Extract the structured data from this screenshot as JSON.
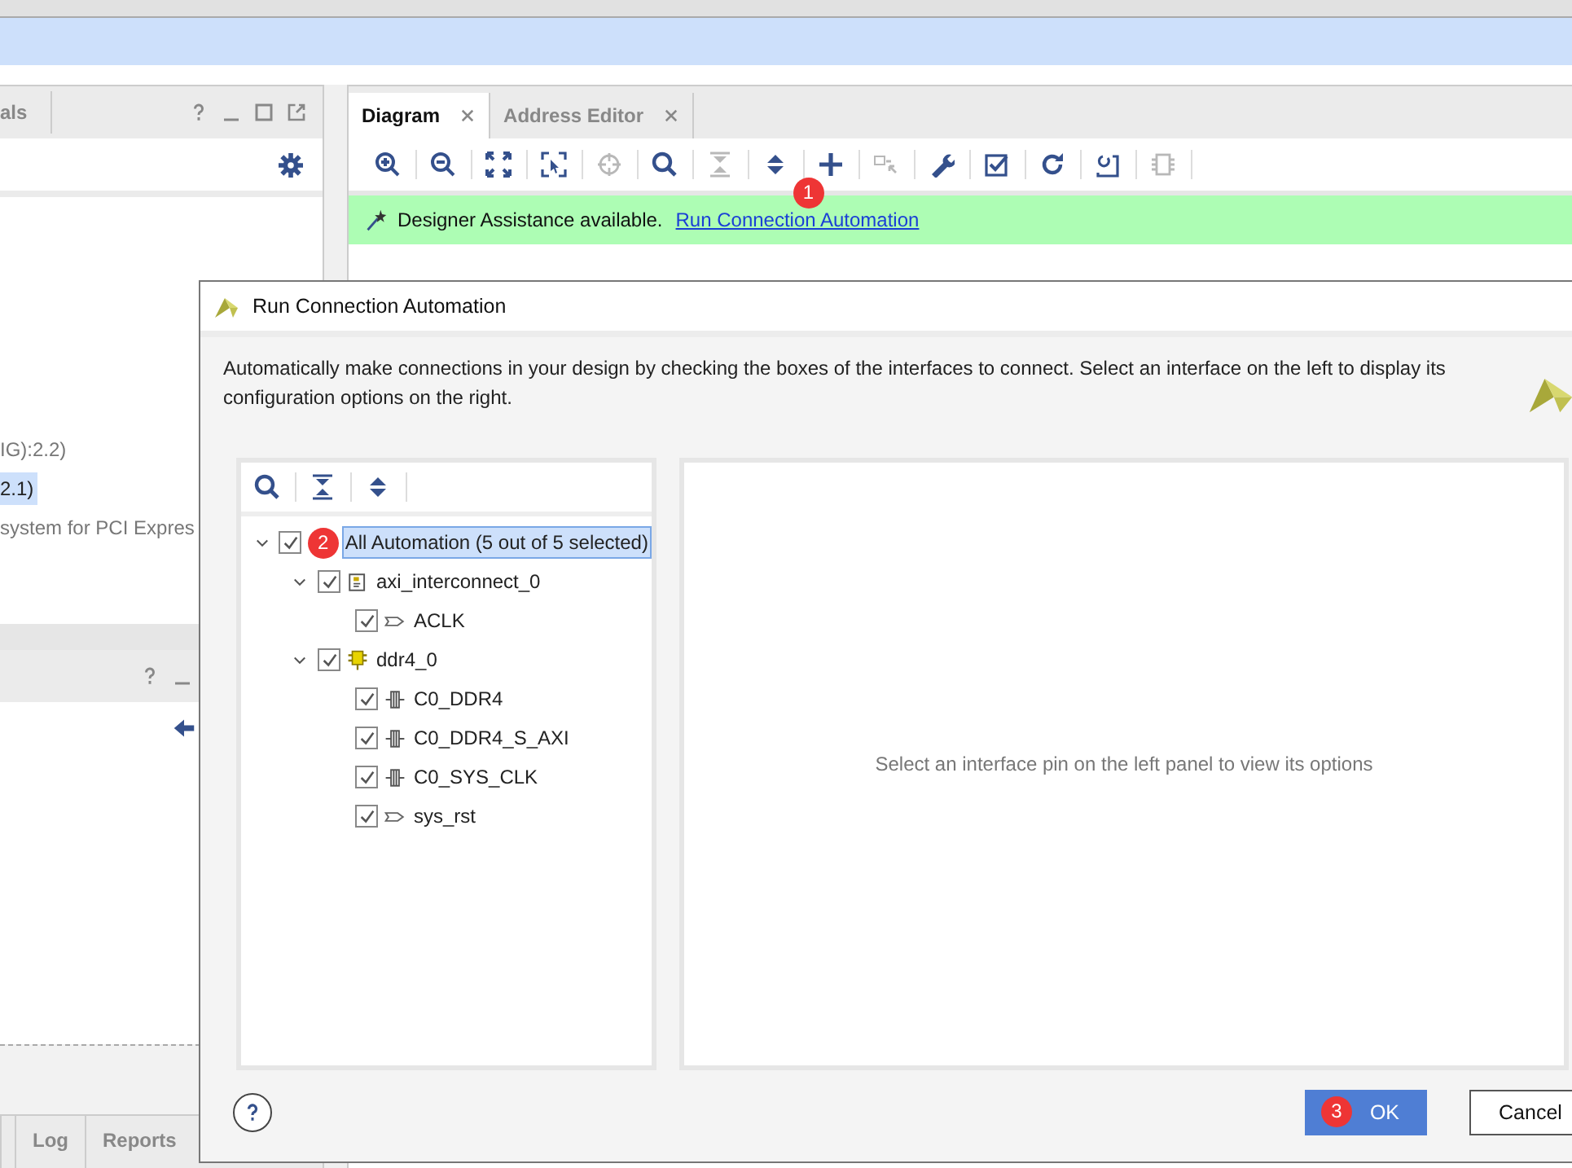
{
  "left_panel": {
    "tab": "als",
    "lines": [
      {
        "text": "IG):2.2)",
        "selected": false
      },
      {
        "text": "2.1)",
        "selected": true
      },
      {
        "text": "system for PCI Expres",
        "selected": false
      }
    ]
  },
  "bottom_tabs": [
    {
      "label": "Log"
    },
    {
      "label": "Reports"
    }
  ],
  "diagram_tabs": [
    {
      "label": "Diagram",
      "selected": true
    },
    {
      "label": "Address Editor",
      "selected": false
    }
  ],
  "diagram_toolbar": [
    {
      "kind": "zoom-in",
      "disabled": false
    },
    {
      "kind": "zoom-out",
      "disabled": false
    },
    {
      "kind": "fit",
      "disabled": false
    },
    {
      "kind": "select-area",
      "disabled": false
    },
    {
      "kind": "crosshair",
      "disabled": true
    },
    {
      "kind": "search",
      "disabled": false
    },
    {
      "kind": "collapse",
      "disabled": true
    },
    {
      "kind": "expand",
      "disabled": false
    },
    {
      "kind": "plus",
      "disabled": false
    },
    {
      "kind": "port",
      "disabled": true
    },
    {
      "kind": "wrench",
      "disabled": false
    },
    {
      "kind": "validate",
      "disabled": false
    },
    {
      "kind": "refresh",
      "disabled": false
    },
    {
      "kind": "regenerate",
      "disabled": false
    },
    {
      "kind": "chip",
      "disabled": true
    }
  ],
  "banner": {
    "text": "Designer Assistance available.",
    "link": "Run Connection Automation",
    "badge": "1"
  },
  "dialog": {
    "title": "Run Connection Automation",
    "description": "Automatically make connections in your design by checking the boxes of the interfaces to connect. Select an interface on the left to display its configuration options on the right.",
    "tree_toolbar": [
      {
        "kind": "search"
      },
      {
        "kind": "collapse"
      },
      {
        "kind": "expand"
      }
    ],
    "tree": [
      {
        "label": "All Automation (5 out of 5 selected)",
        "checked": true,
        "expanded": true,
        "selected": true,
        "badge": "2",
        "children": [
          {
            "label": "axi_interconnect_0",
            "kind": "block",
            "checked": true,
            "expanded": true,
            "selected": false,
            "children": [
              {
                "label": "ACLK",
                "kind": "pin",
                "checked": true,
                "selected": false
              }
            ]
          },
          {
            "label": "ddr4_0",
            "kind": "ip",
            "checked": true,
            "expanded": true,
            "selected": false,
            "children": [
              {
                "label": "C0_DDR4",
                "kind": "bus",
                "checked": true,
                "selected": false
              },
              {
                "label": "C0_DDR4_S_AXI",
                "kind": "bus",
                "checked": true,
                "selected": false
              },
              {
                "label": "C0_SYS_CLK",
                "kind": "bus",
                "checked": true,
                "selected": false
              },
              {
                "label": "sys_rst",
                "kind": "pin",
                "checked": true,
                "selected": false
              }
            ]
          }
        ]
      }
    ],
    "hint": "Select an interface pin on the left panel to view its options",
    "buttons": [
      {
        "label": "OK",
        "kind": "primary",
        "badge": "3"
      },
      {
        "label": "Cancel",
        "kind": "secondary"
      }
    ]
  }
}
